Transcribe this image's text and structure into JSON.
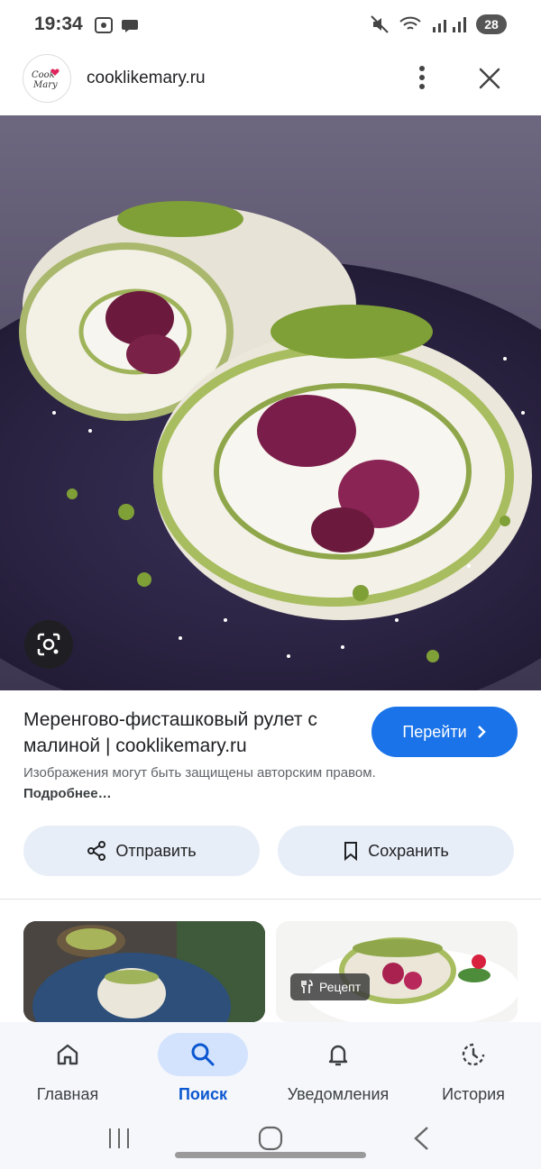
{
  "status": {
    "time": "19:34",
    "battery": "28"
  },
  "header": {
    "site": "cooklikemary.ru",
    "logo_text": "Cook like Mary"
  },
  "result": {
    "title": "Меренгово-фисташковый рулет с малиной | cooklikemary.ru",
    "goto_label": "Перейти",
    "notice_text": "Изображения могут быть защищены авторским правом.",
    "notice_more": "Подробнее…"
  },
  "actions": {
    "share": "Отправить",
    "save": "Сохранить"
  },
  "related": {
    "recipe_badge": "Рецепт"
  },
  "nav": {
    "items": [
      {
        "label": "Главная",
        "icon": "home-icon"
      },
      {
        "label": "Поиск",
        "icon": "search-icon"
      },
      {
        "label": "Уведомления",
        "icon": "bell-icon"
      },
      {
        "label": "История",
        "icon": "history-icon"
      }
    ],
    "active": 1
  },
  "colors": {
    "accent": "#1a73e8",
    "pill_bg": "#e8eef8",
    "nav_active_bg": "#d3e3fd",
    "pistachio": "#7fa037",
    "raspberry": "#7a1d4a"
  }
}
